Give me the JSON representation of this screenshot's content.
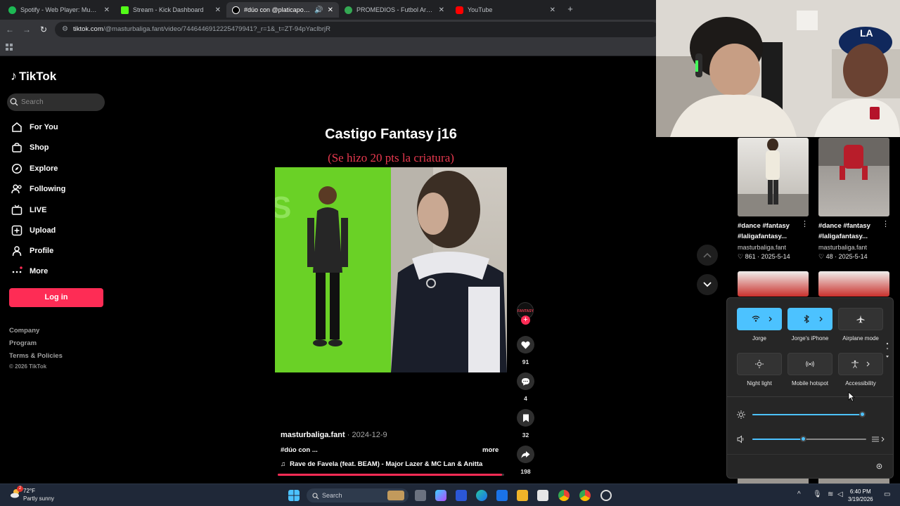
{
  "browser": {
    "tabs": [
      {
        "title": "Spotify - Web Player: Music for",
        "color": "#1db954"
      },
      {
        "title": "Stream - Kick Dashboard",
        "color": "#53fc18"
      },
      {
        "title": "#dúo con @platicapolinesia",
        "color": "#ffffff"
      },
      {
        "title": "PROMEDIOS - Futbol Argentino",
        "color": "#34a853"
      },
      {
        "title": "YouTube",
        "color": "#ff0000"
      }
    ],
    "url_host": "tiktok.com",
    "url_path": "/@masturbaliga.fant/video/7446446912225479941?_r=1&_t=ZT-94pYaclbrjR"
  },
  "sidebar": {
    "logo": "TikTok",
    "search_placeholder": "Search",
    "nav": [
      {
        "label": "For You",
        "icon": "home-icon"
      },
      {
        "label": "Shop",
        "icon": "shop-icon"
      },
      {
        "label": "Explore",
        "icon": "compass-icon"
      },
      {
        "label": "Following",
        "icon": "following-icon"
      },
      {
        "label": "LIVE",
        "icon": "live-icon"
      },
      {
        "label": "Upload",
        "icon": "upload-icon"
      },
      {
        "label": "Profile",
        "icon": "profile-icon"
      },
      {
        "label": "More",
        "icon": "more-icon"
      }
    ],
    "login": "Log in",
    "footer": [
      "Company",
      "Program",
      "Terms & Policies"
    ],
    "copyright": "© 2026 TikTok"
  },
  "video": {
    "title": "Castigo Fantasy j16",
    "subtitle": "(Se hizo 20 pts la criatura)",
    "author": "masturbaliga.fant",
    "date": "2024-12-9",
    "description": "#dúo con ...",
    "more": "more",
    "music": "Rave de Favela (feat. BEAM) - Major Lazer & MC Lan & Anitta",
    "progress": 0.99,
    "avatar_text": "FANTASY"
  },
  "actions": {
    "likes": "91",
    "comments": "4",
    "saves": "32",
    "shares": "198"
  },
  "grid": [
    {
      "title": "#dance #fantasy #laligafantasy...",
      "user": "masturbaliga.fant",
      "likes": "861 · 2025-5-14"
    },
    {
      "title": "#dance #fantasy #laligafantasy...",
      "user": "masturbaliga.fant",
      "likes": "48 · 2025-5-14"
    }
  ],
  "quick_settings": {
    "tiles": [
      {
        "label": "Jorge",
        "icon": "wifi-icon",
        "on": true
      },
      {
        "label": "Jorge's iPhone",
        "icon": "bluetooth-icon",
        "on": true
      },
      {
        "label": "Airplane mode",
        "icon": "airplane-icon",
        "on": false
      },
      {
        "label": "Night light",
        "icon": "night-light-icon",
        "on": false
      },
      {
        "label": "Mobile hotspot",
        "icon": "hotspot-icon",
        "on": false
      },
      {
        "label": "Accessibility",
        "icon": "accessibility-icon",
        "on": false
      }
    ],
    "brightness": 0.98,
    "volume": 0.45
  },
  "taskbar": {
    "weather_temp": "72°F",
    "weather_cond": "Partly sunny",
    "weather_badge": "2",
    "search": "Search",
    "time": "6:40 PM",
    "date": "3/19/2026"
  }
}
